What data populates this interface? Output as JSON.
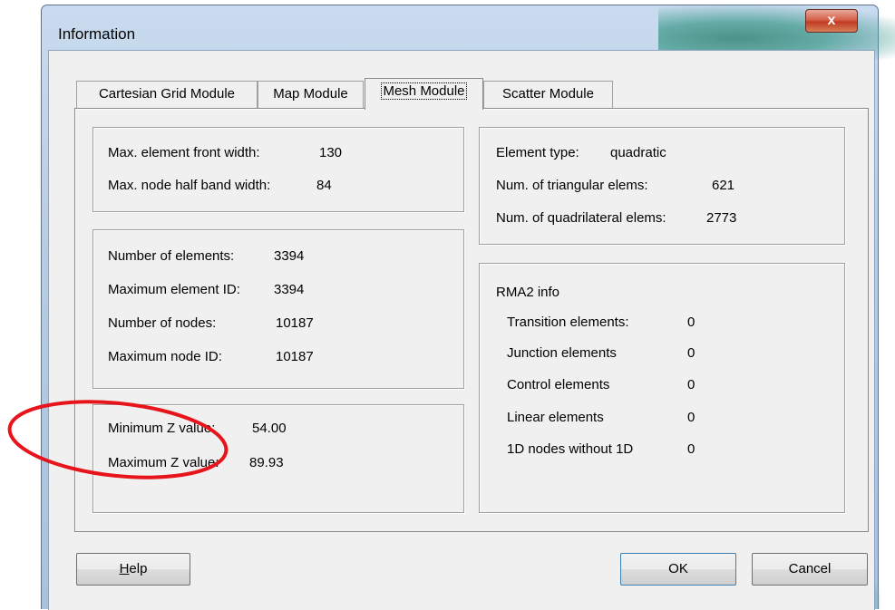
{
  "window": {
    "title": "Information",
    "close_glyph": "x"
  },
  "tabs": [
    {
      "label": "Cartesian Grid Module",
      "active": false
    },
    {
      "label": "Map Module",
      "active": false
    },
    {
      "label": "Mesh Module",
      "active": true
    },
    {
      "label": "Scatter Module",
      "active": false
    }
  ],
  "front_width_group": {
    "max_front_label": "Max. element front width:",
    "max_front_value": "130",
    "half_band_label": "Max. node half band width:",
    "half_band_value": "84"
  },
  "counts_group": {
    "rows": [
      {
        "label": "Number of elements:",
        "value": "3394"
      },
      {
        "label": "Maximum element ID:",
        "value": "3394"
      },
      {
        "label": "Number of nodes:",
        "value": "10187"
      },
      {
        "label": "Maximum node ID:",
        "value": "10187"
      }
    ]
  },
  "z_group": {
    "min_label": "Minimum Z value:",
    "min_value": "54.00",
    "max_label": "Maximum Z value:",
    "max_value": "89.93"
  },
  "element_type_group": {
    "type_label": "Element type:",
    "type_value": "quadratic",
    "tri_label": "Num. of triangular elems:",
    "tri_value": "621",
    "quad_label": "Num. of quadrilateral elems:",
    "quad_value": "2773"
  },
  "rma2_group": {
    "title": "RMA2 info",
    "rows": [
      {
        "label": "Transition elements:",
        "value": "0"
      },
      {
        "label": "Junction elements",
        "value": "0"
      },
      {
        "label": "Control elements",
        "value": "0"
      },
      {
        "label": "Linear elements",
        "value": "0"
      },
      {
        "label": "1D nodes without 1D",
        "value": "0"
      }
    ]
  },
  "buttons": {
    "help_hotkey": "H",
    "help_rest": "elp",
    "ok": "OK",
    "cancel": "Cancel"
  },
  "annotation": {
    "color": "#e8141c",
    "icon": "red-ellipse-annotation"
  }
}
